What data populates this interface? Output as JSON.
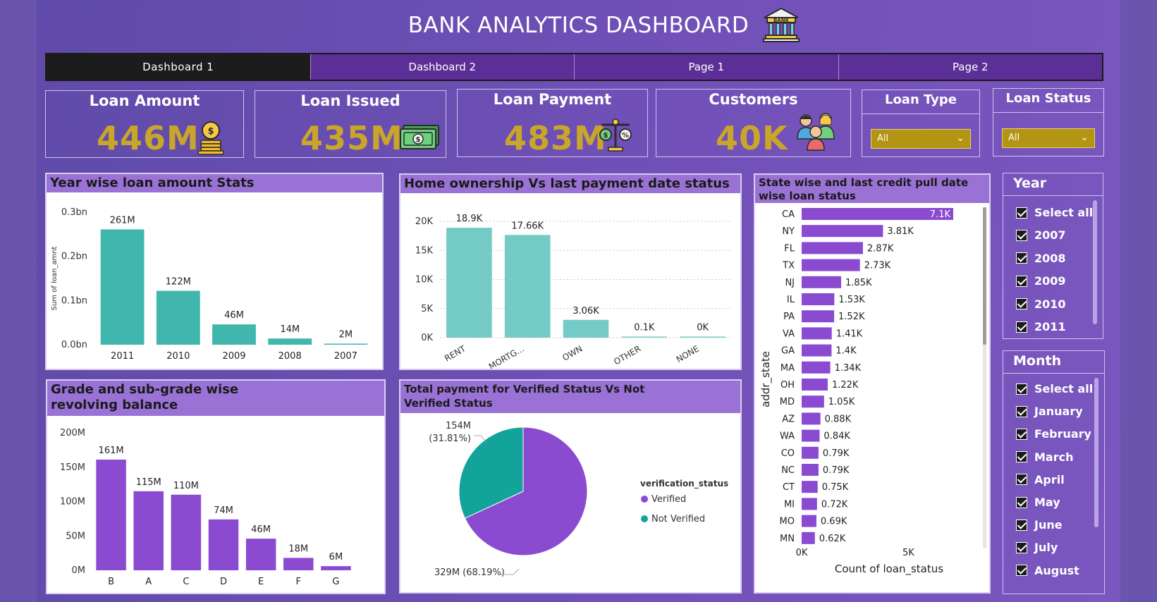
{
  "header": {
    "title": "BANK ANALYTICS DASHBOARD",
    "bank_icon_text": "BANK"
  },
  "tabs": [
    "Dashboard 1",
    "Dashboard 2",
    "Page 1",
    "Page 2"
  ],
  "kpis": [
    {
      "label": "Loan Amount",
      "value": "446M",
      "icon": "gold-coins-icon"
    },
    {
      "label": "Loan Issued",
      "value": "435M",
      "icon": "cash-icon"
    },
    {
      "label": "Loan Payment",
      "value": "483M",
      "icon": "balance-scale-icon"
    },
    {
      "label": "Customers",
      "value": "40K",
      "icon": "people-icon"
    }
  ],
  "slicers": {
    "loan_type": {
      "title": "Loan Type",
      "value": "All"
    },
    "loan_status": {
      "title": "Loan Status",
      "value": "All"
    }
  },
  "year_filter": {
    "title": "Year",
    "items": [
      "Select all",
      "2007",
      "2008",
      "2009",
      "2010",
      "2011"
    ]
  },
  "month_filter": {
    "title": "Month",
    "items": [
      "Select all",
      "January",
      "February",
      "March",
      "April",
      "May",
      "June",
      "July",
      "August"
    ]
  },
  "colors": {
    "teal": "#41b6ac",
    "teal_light": "#74cac4",
    "purple": "#8a4bd0",
    "pie_teal": "#12a39a",
    "gold": "#c9a62a"
  },
  "chart_data": [
    {
      "id": "year_wise",
      "type": "bar",
      "title": "Year wise loan amount Stats",
      "ylabel": "Sum of loan_amnt",
      "yticks": [
        "0.3bn",
        "0.2bn",
        "0.1bn",
        "0.0bn"
      ],
      "ylim": [
        0,
        300
      ],
      "categories": [
        "2011",
        "2010",
        "2009",
        "2008",
        "2007"
      ],
      "values": [
        261,
        122,
        46,
        14,
        2
      ],
      "labels": [
        "261M",
        "122M",
        "46M",
        "14M",
        "2M"
      ]
    },
    {
      "id": "home_ownership",
      "type": "bar",
      "title": "Home ownership Vs last payment date status",
      "yticks": [
        "20K",
        "15K",
        "10K",
        "5K",
        "0K"
      ],
      "ylim": [
        0,
        20
      ],
      "categories": [
        "RENT",
        "MORTG...",
        "OWN",
        "OTHER",
        "NONE"
      ],
      "values": [
        18.9,
        17.66,
        3.06,
        0.1,
        0.05
      ],
      "labels": [
        "18.9K",
        "17.66K",
        "3.06K",
        "0.1K",
        "0K"
      ]
    },
    {
      "id": "grade_wise",
      "type": "bar",
      "title": "Grade and sub-grade wise revolving balance",
      "yticks": [
        "200M",
        "150M",
        "100M",
        "50M",
        "0M"
      ],
      "ylim": [
        0,
        200
      ],
      "categories": [
        "B",
        "A",
        "C",
        "D",
        "E",
        "F",
        "G"
      ],
      "values": [
        161,
        115,
        110,
        74,
        46,
        18,
        6
      ],
      "labels": [
        "161M",
        "115M",
        "110M",
        "74M",
        "46M",
        "18M",
        "6M"
      ]
    },
    {
      "id": "verification",
      "type": "pie",
      "title": "Total payment for Verified Status Vs Not Verified Status",
      "legend_title": "verification_status",
      "series": [
        {
          "name": "Verified",
          "value": 329,
          "pct": 68.19,
          "label": "329M (68.19%)"
        },
        {
          "name": "Not Verified",
          "value": 154,
          "pct": 31.81,
          "label": "154M",
          "sublabel": "(31.81%)"
        }
      ]
    },
    {
      "id": "state_wise",
      "type": "bar",
      "orientation": "horizontal",
      "title": "State wise and last credit pull date wise loan status",
      "ylabel": "addr_state",
      "xlabel": "Count of loan_status",
      "xticks": [
        "0K",
        "5K"
      ],
      "xlim": [
        0,
        7.1
      ],
      "categories": [
        "CA",
        "NY",
        "FL",
        "TX",
        "NJ",
        "IL",
        "PA",
        "VA",
        "GA",
        "MA",
        "OH",
        "MD",
        "AZ",
        "WA",
        "CO",
        "NC",
        "CT",
        "MI",
        "MO",
        "MN"
      ],
      "values": [
        7.1,
        3.81,
        2.87,
        2.73,
        1.85,
        1.53,
        1.52,
        1.41,
        1.4,
        1.34,
        1.22,
        1.05,
        0.88,
        0.84,
        0.79,
        0.79,
        0.75,
        0.72,
        0.69,
        0.62
      ],
      "labels": [
        "7.1K",
        "3.81K",
        "2.87K",
        "2.73K",
        "1.85K",
        "1.53K",
        "1.52K",
        "1.41K",
        "1.4K",
        "1.34K",
        "1.22K",
        "1.05K",
        "0.88K",
        "0.84K",
        "0.79K",
        "0.79K",
        "0.75K",
        "0.72K",
        "0.69K",
        "0.62K"
      ]
    }
  ]
}
